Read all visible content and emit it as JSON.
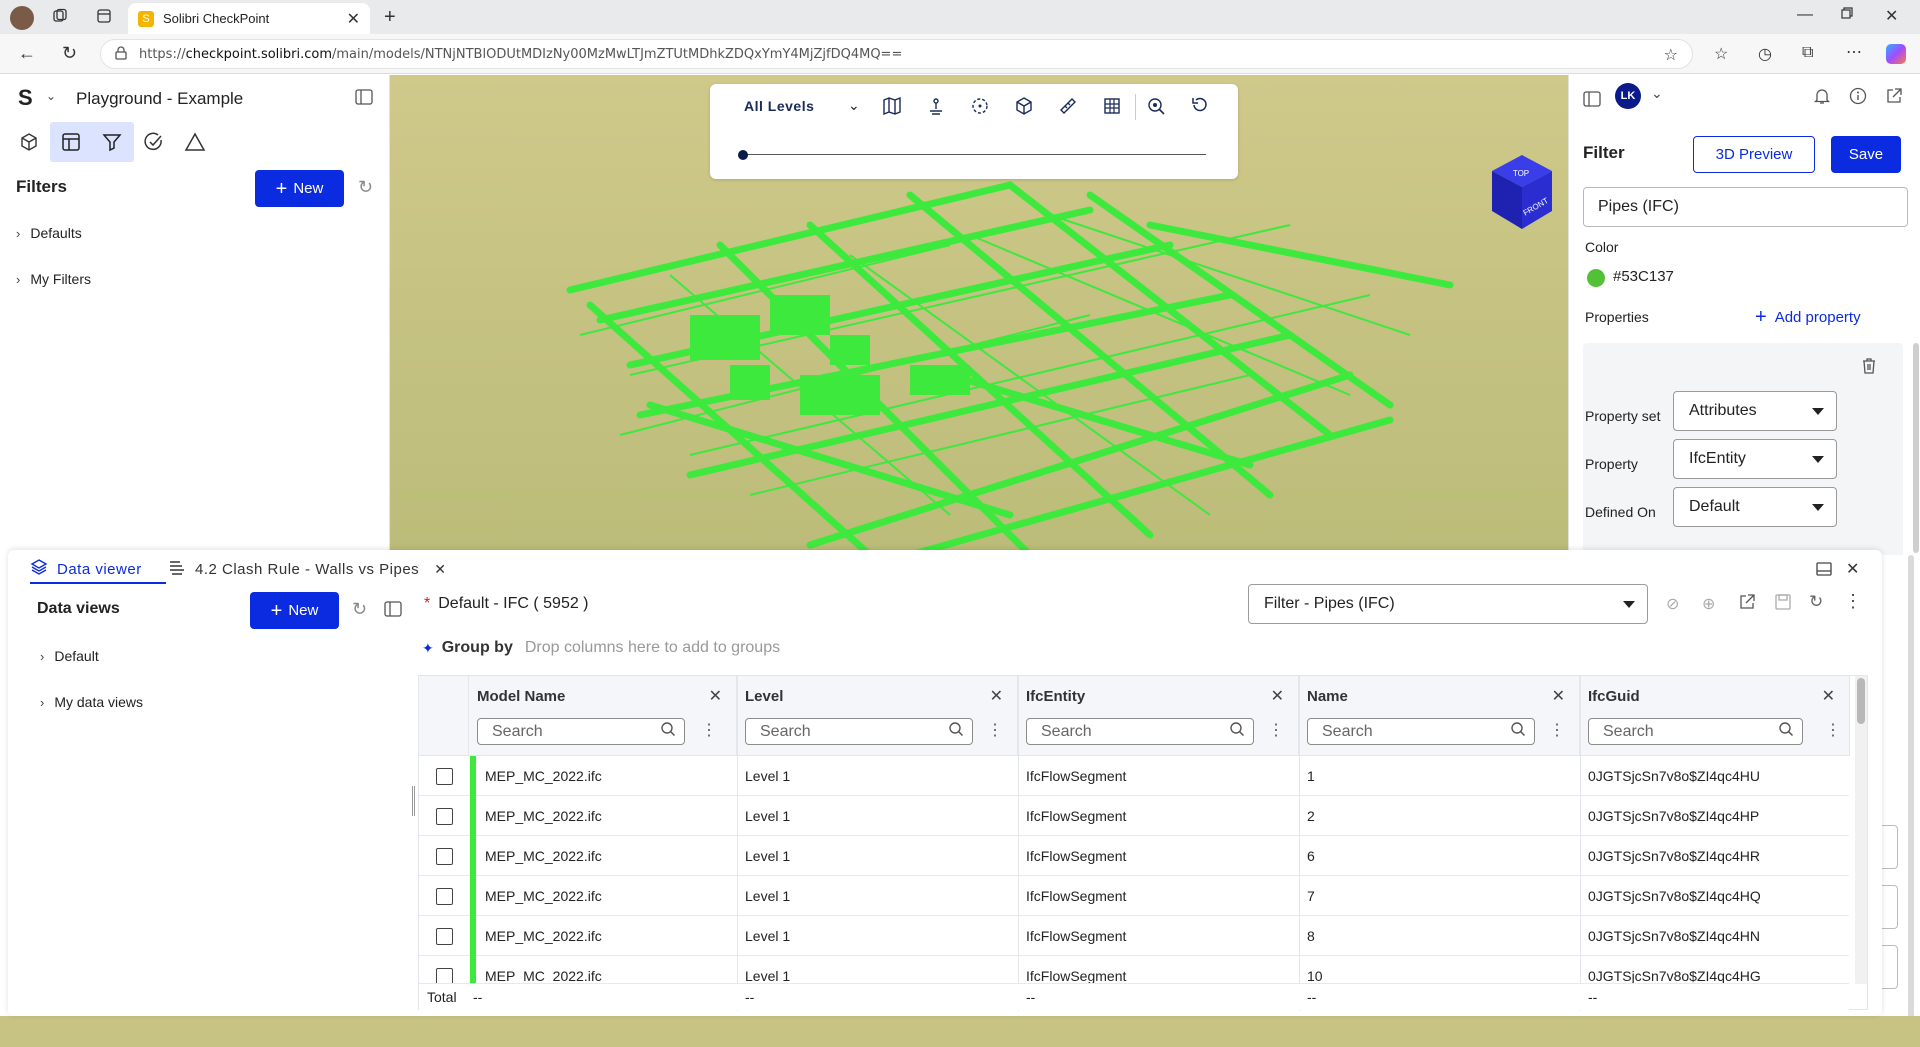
{
  "browser": {
    "tab_title": "Solibri CheckPoint",
    "url_prefix": "https://",
    "url_host": "checkpoint.solibri.com",
    "url_path": "/main/models/NTNjNTBlODUtMDIzNy00MzMwLTJmZTUtMDhkZDQxYmY4MjZjfDQ4MQ=="
  },
  "app": {
    "logo": "S",
    "project_title": "Playground - Example"
  },
  "left": {
    "section_title": "Filters",
    "new_label": "New",
    "tree": [
      {
        "label": "Defaults"
      },
      {
        "label": "My Filters"
      }
    ]
  },
  "viewport": {
    "level_select": "All Levels",
    "nav_cube_top": "TOP",
    "nav_cube_front": "FRONT"
  },
  "right": {
    "avatar": "LK",
    "title": "Filter",
    "preview_label": "3D Preview",
    "save_label": "Save",
    "filter_name": "Pipes (IFC)",
    "color_label": "Color",
    "color_value": "#53C137",
    "color_hex": "#53C137",
    "properties_label": "Properties",
    "add_property_label": "Add property",
    "rows": [
      {
        "label": "Property set",
        "value": "Attributes"
      },
      {
        "label": "Property",
        "value": "IfcEntity"
      },
      {
        "label": "Defined On",
        "value": "Default"
      }
    ]
  },
  "bottom": {
    "tabs": [
      {
        "label": "Data viewer"
      },
      {
        "label": "4.2 Clash Rule - Walls vs Pipes"
      }
    ],
    "data_views_title": "Data views",
    "new_label": "New",
    "tree": [
      {
        "label": "Default"
      },
      {
        "label": "My data views"
      }
    ],
    "view_title_marker": "*",
    "view_title": "Default - IFC ( 5952 )",
    "filter_select": "Filter - Pipes (IFC)",
    "group_by_label": "Group by",
    "group_by_hint": "Drop columns here to add to groups",
    "search_placeholder": "Search",
    "columns": [
      "Model Name",
      "Level",
      "IfcEntity",
      "Name",
      "IfcGuid"
    ],
    "rows": [
      [
        "MEP_MC_2022.ifc",
        "Level 1",
        "IfcFlowSegment",
        "1",
        "0JGTSjcSn7v8o$ZI4qc4HU"
      ],
      [
        "MEP_MC_2022.ifc",
        "Level 1",
        "IfcFlowSegment",
        "2",
        "0JGTSjcSn7v8o$ZI4qc4HP"
      ],
      [
        "MEP_MC_2022.ifc",
        "Level 1",
        "IfcFlowSegment",
        "6",
        "0JGTSjcSn7v8o$ZI4qc4HR"
      ],
      [
        "MEP_MC_2022.ifc",
        "Level 1",
        "IfcFlowSegment",
        "7",
        "0JGTSjcSn7v8o$ZI4qc4HQ"
      ],
      [
        "MEP_MC_2022.ifc",
        "Level 1",
        "IfcFlowSegment",
        "8",
        "0JGTSjcSn7v8o$ZI4qc4HN"
      ],
      [
        "MEP_MC_2022.ifc",
        "Level 1",
        "IfcFlowSegment",
        "10",
        "0JGTSjcSn7v8o$ZI4qc4HG"
      ]
    ],
    "total_label": "Total",
    "total_values": [
      "--",
      "--",
      "--",
      "--",
      "--"
    ]
  },
  "colors": {
    "accent": "#0b2be0",
    "pipe_green": "#3ee93e"
  }
}
